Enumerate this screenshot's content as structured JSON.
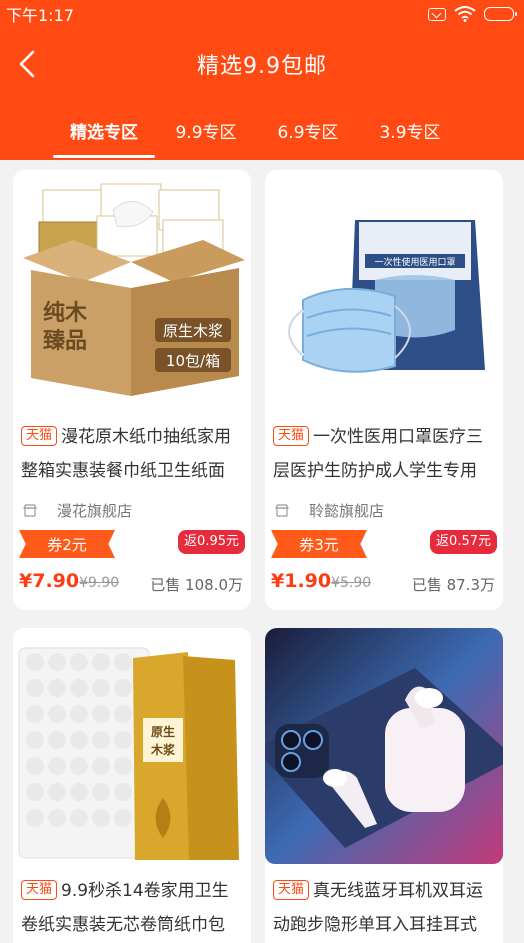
{
  "status": {
    "time": "下午1:17"
  },
  "header": {
    "title": "精选9.9包邮"
  },
  "tabs": [
    {
      "label": "精选专区"
    },
    {
      "label": "9.9专区"
    },
    {
      "label": "6.9专区"
    },
    {
      "label": "3.9专区"
    }
  ],
  "colors": {
    "brand": "#ff4a14",
    "price": "#ff3b14",
    "rebate": "#e52b3c"
  },
  "products": [
    {
      "title": "漫花原木纸巾抽纸家用整箱实惠装餐巾纸卫生纸面",
      "tag": "天猫",
      "shop": "漫花旗舰店",
      "coupon": "券2元",
      "rebate": "返0.95元",
      "price": "¥7.90",
      "old_price": "¥9.90",
      "sold": "已售 108.0万",
      "image_text": {
        "box_brand": "纯木臻品",
        "box_side": "原生木浆",
        "box_count": "10包/箱"
      }
    },
    {
      "title": "一次性医用口罩医疗三层医护生防护成人学生专用",
      "tag": "天猫",
      "shop": "聆懿旗舰店",
      "coupon": "券3元",
      "rebate": "返0.57元",
      "price": "¥1.90",
      "old_price": "¥5.90",
      "sold": "已售 87.3万",
      "image_text": {
        "pack_label": "一次性使用医用口罩"
      }
    },
    {
      "title": "9.9秒杀14卷家用卫生卷纸实惠装无芯卷筒纸巾包",
      "tag": "天猫",
      "image_text": {
        "pack_label": "原生木浆"
      }
    },
    {
      "title": "真无线蓝牙耳机双耳运动跑步隐形单耳入耳挂耳式",
      "tag": "天猫"
    }
  ]
}
